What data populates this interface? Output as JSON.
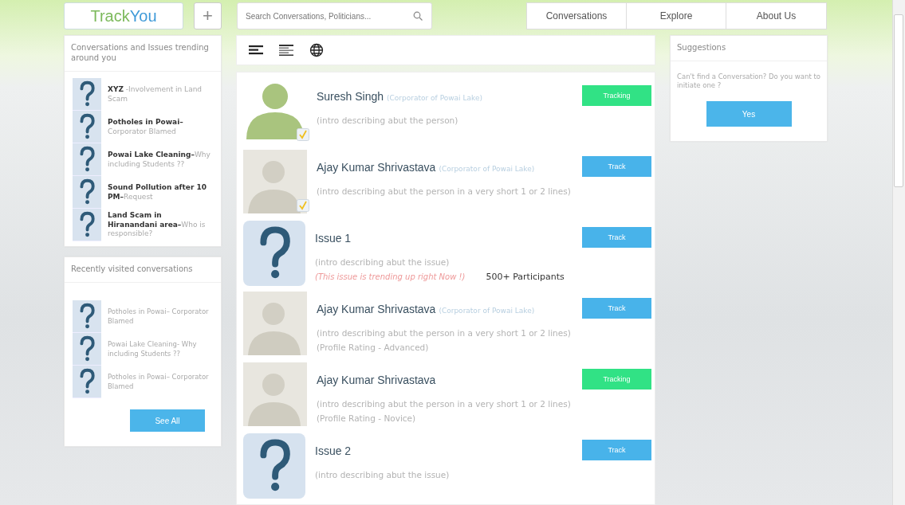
{
  "header": {
    "logo": {
      "first": "Track",
      "second": "You"
    },
    "add_button": "+",
    "search": {
      "placeholder": "Search Conversations, Politicians..."
    },
    "nav": [
      {
        "label": "Conversations"
      },
      {
        "label": "Explore"
      },
      {
        "label": "About Us"
      }
    ]
  },
  "trending": {
    "title": "Conversations and Issues trending around you",
    "items": [
      {
        "title": "XYZ",
        "detail": " -Involvement in Land Scam"
      },
      {
        "title": "Potholes in Powai–",
        "detail": "Corporator Blamed"
      },
      {
        "title": "Powai Lake Cleaning–",
        "detail": "Why including Students ??"
      },
      {
        "title": "Sound Pollution after 10 PM–",
        "detail": "Request"
      },
      {
        "title": "Land Scam in Hiranandani area–",
        "detail": "Who is responsible?"
      }
    ]
  },
  "recent": {
    "title": "Recently visited conversations",
    "items": [
      {
        "text": "Potholes in Powai– Corporator Blamed"
      },
      {
        "text": "Powai Lake Cleaning- Why including Students ??"
      },
      {
        "text": "Potholes in Powai– Corporator Blamed"
      }
    ],
    "see_all": "See All"
  },
  "feed": [
    {
      "kind": "member",
      "verified": true,
      "name": "Suresh Singh",
      "role": "(Corporator of Powai Lake)",
      "intro": "(intro describing abut the person)",
      "button": "Tracking",
      "tracking": true
    },
    {
      "kind": "person",
      "verified": true,
      "name": "Ajay Kumar Shrivastava",
      "role": "(Corporator of Powai Lake)",
      "intro": "(intro describing abut the person in a very short 1 or 2 lines)",
      "button": "Track",
      "tracking": false
    },
    {
      "kind": "issue",
      "name": "Issue 1",
      "intro": "(intro describing abut the issue)",
      "trend": "(This issue is trending up right Now !)",
      "participants": "500+ Participants",
      "button": "Track",
      "tracking": false
    },
    {
      "kind": "person",
      "verified": false,
      "name": "Ajay Kumar Shrivastava",
      "role": "(Corporator of Powai Lake)",
      "intro": "(intro describing abut the person in a very short 1 or 2 lines)",
      "rating": "(Profile Rating - Advanced)",
      "button": "Track",
      "tracking": false
    },
    {
      "kind": "person",
      "verified": false,
      "name": "Ajay Kumar Shrivastava",
      "intro": "(intro describing abut the person in a very short 1 or 2 lines)",
      "rating": "(Profile Rating - Novice)",
      "button": "Tracking",
      "tracking": true
    },
    {
      "kind": "issue",
      "name": "Issue 2",
      "intro": "(intro describing abut the issue)",
      "button": "Track",
      "tracking": false
    }
  ],
  "suggestions": {
    "title": "Suggestions",
    "text": "Can't find a Conversation? Do you want to initiate one ?",
    "button": "Yes"
  }
}
